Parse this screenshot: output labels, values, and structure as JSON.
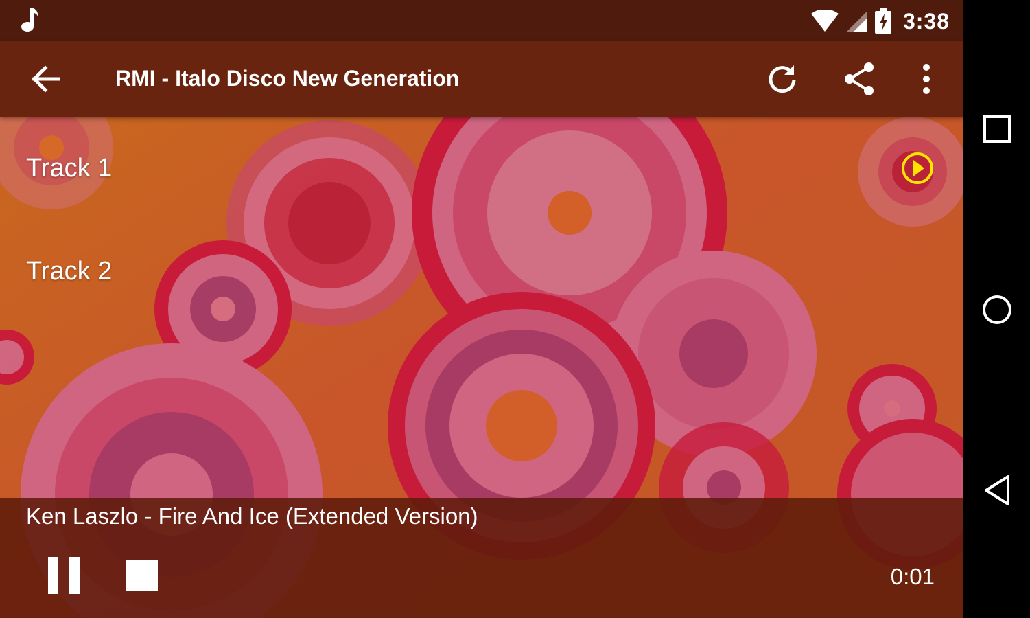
{
  "status_bar": {
    "time": "3:38",
    "icons": [
      "music-note-icon",
      "wifi-icon",
      "cell-signal-icon",
      "battery-charging-icon"
    ]
  },
  "app_bar": {
    "title": "RMI - Italo Disco New Generation",
    "icons": [
      "back-arrow-icon",
      "refresh-icon",
      "share-icon",
      "overflow-menu-icon"
    ]
  },
  "tracks": [
    {
      "label": "Track 1",
      "playing": true
    },
    {
      "label": "Track 2",
      "playing": false
    }
  ],
  "player": {
    "now_playing": "Ken Laszlo - Fire And Ice (Extended Version)",
    "elapsed": "0:01",
    "icons": [
      "pause-icon",
      "stop-icon"
    ]
  },
  "navigation_bar": {
    "icons": [
      "recents-square-icon",
      "home-circle-icon",
      "back-triangle-icon"
    ]
  },
  "colors": {
    "status_bar": "#4f1b0c",
    "app_bar": "#69240f",
    "background_orange": "#c3561f",
    "circle_crimson": "#c8153d",
    "circle_pink": "#d1678c",
    "playing_indicator": "#ffe400"
  }
}
